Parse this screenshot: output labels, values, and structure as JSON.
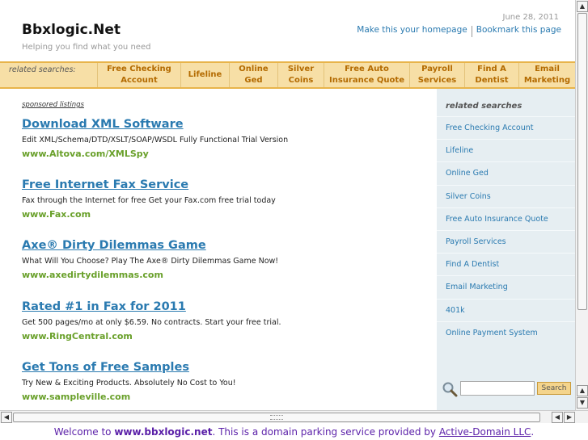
{
  "header": {
    "site_title": "Bbxlogic.Net",
    "tagline": "Helping you find what you need",
    "date": "June 28, 2011",
    "make_homepage": "Make this your homepage",
    "bookmark": "Bookmark this page"
  },
  "related_bar": {
    "label": "related searches:",
    "items": [
      {
        "line1": "Free Checking",
        "line2": "Account"
      },
      {
        "line1": "Lifeline",
        "line2": ""
      },
      {
        "line1": "Online",
        "line2": "Ged"
      },
      {
        "line1": "Silver",
        "line2": "Coins"
      },
      {
        "line1": "Free Auto",
        "line2": "Insurance Quote"
      },
      {
        "line1": "Payroll",
        "line2": "Services"
      },
      {
        "line1": "Find A",
        "line2": "Dentist"
      },
      {
        "line1": "Email",
        "line2": "Marketing"
      }
    ]
  },
  "main": {
    "sponsored_label": "sponsored listings",
    "listings": [
      {
        "title": "Download XML Software",
        "desc": "Edit XML/Schema/DTD/XSLT/SOAP/WSDL Fully Functional Trial Version",
        "url": "www.Altova.com/XMLSpy"
      },
      {
        "title": "Free Internet Fax Service",
        "desc": "Fax through the Internet for free Get your Fax.com free trial today",
        "url": "www.Fax.com"
      },
      {
        "title": "Axe® Dirty Dilemmas Game",
        "desc": "What Will You Choose? Play The Axe® Dirty Dilemmas Game Now!",
        "url": "www.axedirtydilemmas.com"
      },
      {
        "title": "Rated #1 in Fax for 2011",
        "desc": "Get 500 pages/mo at only $6.59. No contracts. Start your free trial.",
        "url": "www.RingCentral.com"
      },
      {
        "title": "Get Tons of Free Samples",
        "desc": "Try New & Exciting Products. Absolutely No Cost to You!",
        "url": "www.sampleville.com"
      }
    ]
  },
  "sidebar": {
    "title": "related searches",
    "items": [
      "Free Checking Account",
      "Lifeline",
      "Online Ged",
      "Silver Coins",
      "Free Auto Insurance Quote",
      "Payroll Services",
      "Find A Dentist",
      "Email Marketing",
      "401k",
      "Online Payment System"
    ],
    "search_input_value": "",
    "search_button": "Search"
  },
  "footer": {
    "prefix": "Welcome to ",
    "domain": "www.bbxlogic.net",
    "middle": ". This is a domain parking service provided by ",
    "provider": "Active-Domain LLC",
    "suffix": "."
  },
  "colors": {
    "link": "#2a7ab0",
    "url_green": "#69a02a",
    "bar_bg": "#f7dfa6",
    "bar_text": "#b36a00",
    "sidebar_bg": "#e6eef2",
    "footer_text": "#5a1fa8"
  },
  "icons": {
    "search": "search-magnifier-icon",
    "scroll_up": "arrow-up-icon",
    "scroll_down": "arrow-down-icon",
    "scroll_left": "arrow-left-icon",
    "scroll_right": "arrow-right-icon"
  }
}
